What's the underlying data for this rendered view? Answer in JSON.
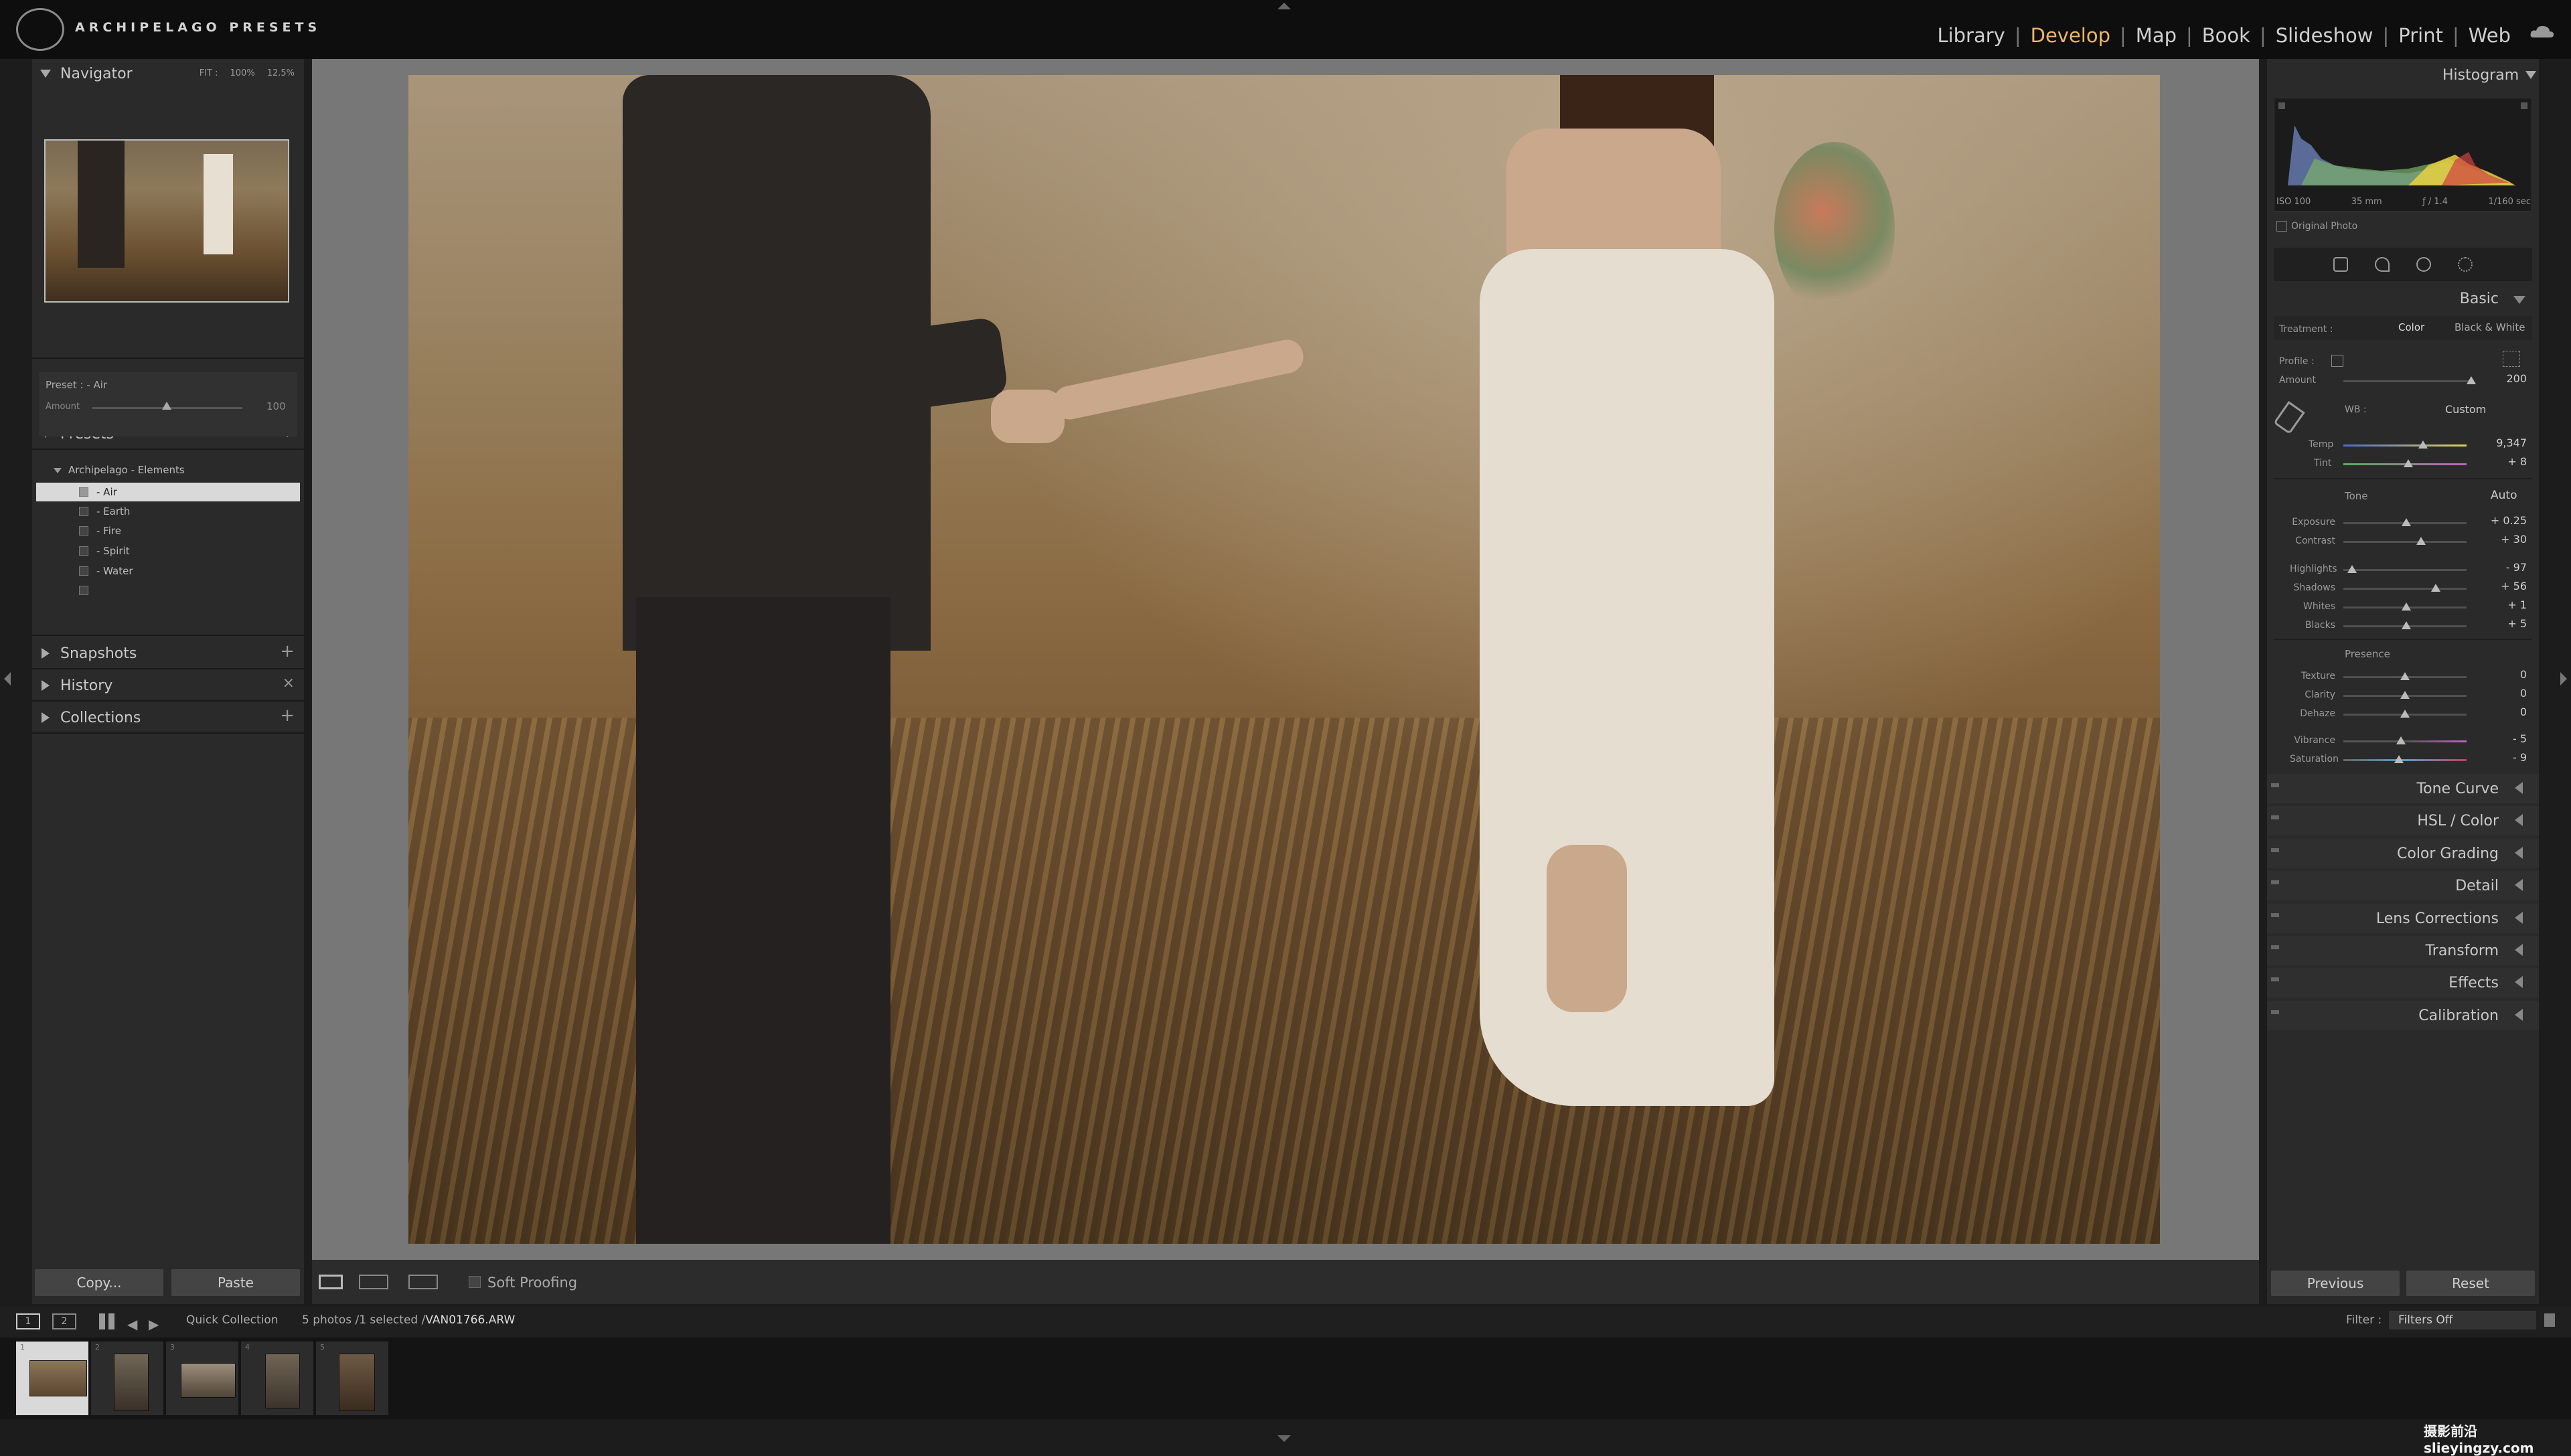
{
  "brand": {
    "logo_name": "archipelago-logo",
    "title": "ARCHIPELAGO PRESETS"
  },
  "modules": [
    "Library",
    "Develop",
    "Map",
    "Book",
    "Slideshow",
    "Print",
    "Web"
  ],
  "active_module": "Develop",
  "left_panel": {
    "navigator": {
      "title": "Navigator",
      "zoom_levels": [
        "FIT :",
        "100%",
        "12.5%"
      ]
    },
    "preset_info": {
      "preset_label": "Preset : - Air",
      "amount_label": "Amount",
      "amount_value": "100"
    },
    "presets": {
      "title": "Presets",
      "group": "Archipelago - Elements",
      "items": [
        "- Air",
        "- Earth",
        "- Fire",
        "- Spirit",
        "- Water",
        ""
      ],
      "selected_index": 0
    },
    "snapshots": "Snapshots",
    "history": "History",
    "collections": "Collections",
    "copy_button": "Copy...",
    "paste_button": "Paste"
  },
  "toolbar": {
    "soft_proofing": "Soft Proofing"
  },
  "right_panel": {
    "histogram_title": "Histogram",
    "exif": [
      "ISO 100",
      "35 mm",
      "ƒ / 1.4",
      "1/160 sec"
    ],
    "original_photo": "Original Photo",
    "basic": {
      "title": "Basic",
      "treatment_label": "Treatment :",
      "treatment_color": "Color",
      "treatment_bw": "Black & White",
      "profile_label": "Profile :",
      "amount_label": "Amount",
      "amount_value": "200",
      "wb_label": "WB :",
      "wb_value": "Custom",
      "temp": {
        "label": "Temp",
        "value": "9,347"
      },
      "tint": {
        "label": "Tint",
        "value": "+ 8"
      },
      "tone_label": "Tone",
      "auto_label": "Auto",
      "tone_sliders": [
        {
          "label": "Exposure",
          "value": "+ 0.25"
        },
        {
          "label": "Contrast",
          "value": "+ 30"
        },
        {
          "label": "Highlights",
          "value": "- 97"
        },
        {
          "label": "Shadows",
          "value": "+ 56"
        },
        {
          "label": "Whites",
          "value": "+ 1"
        },
        {
          "label": "Blacks",
          "value": "+ 5"
        }
      ],
      "presence_label": "Presence",
      "presence_sliders": [
        {
          "label": "Texture",
          "value": "0"
        },
        {
          "label": "Clarity",
          "value": "0"
        },
        {
          "label": "Dehaze",
          "value": "0"
        },
        {
          "label": "Vibrance",
          "value": "- 5"
        },
        {
          "label": "Saturation",
          "value": "- 9"
        }
      ]
    },
    "sections": [
      "Tone Curve",
      "HSL / Color",
      "Color Grading",
      "Detail",
      "Lens Corrections",
      "Transform",
      "Effects",
      "Calibration"
    ],
    "previous_button": "Previous",
    "reset_button": "Reset"
  },
  "filmstrip": {
    "screen1": "1",
    "screen2": "2",
    "source": "Quick Collection",
    "count": "5 photos /1 selected /",
    "filename": "VAN01766.ARW",
    "filter_label": "Filter :",
    "filter_value": "Filters Off",
    "thumb_numbers": [
      "1",
      "2",
      "3",
      "4",
      "5"
    ]
  },
  "watermark": "摄影前沿 slieyingzy.com",
  "colors": {
    "accent": "#e9b66a",
    "panel": "#2a2a2a",
    "selected_row": "#d9d9d9"
  }
}
